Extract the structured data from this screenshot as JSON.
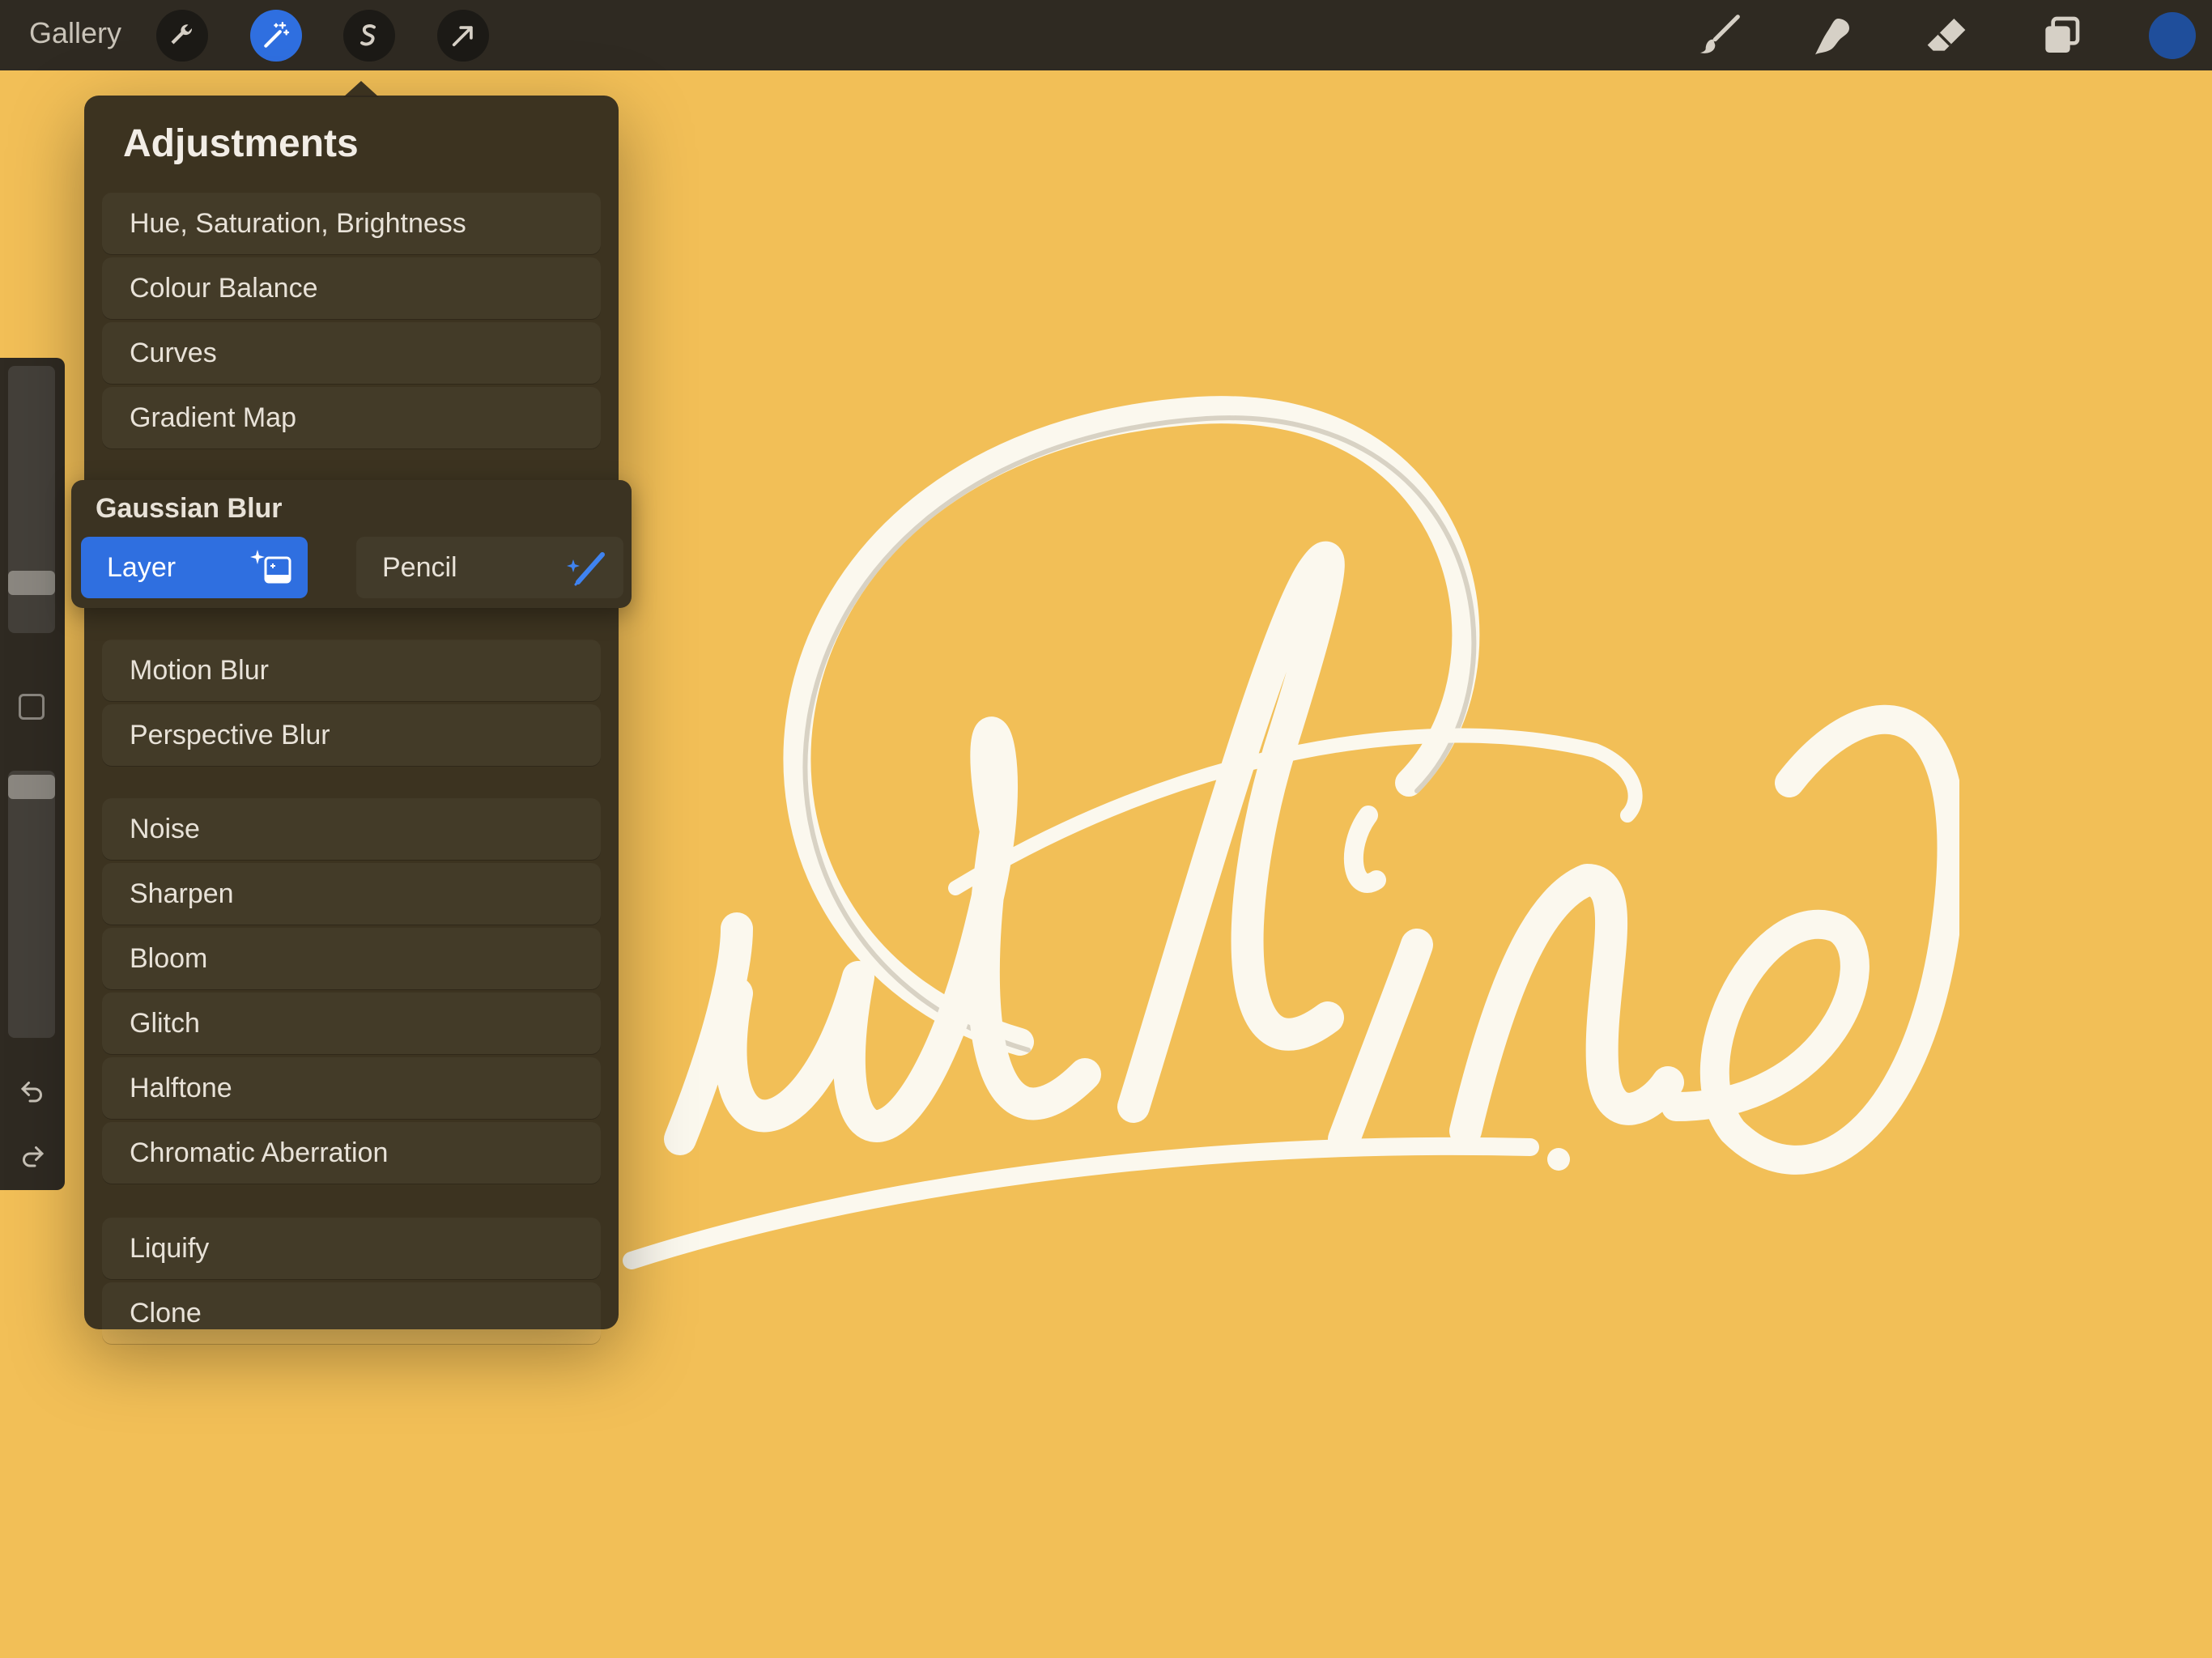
{
  "toolbar": {
    "gallery_label": "Gallery",
    "left_tools": [
      "wrench-icon",
      "magic-wand-icon",
      "selection-icon",
      "transform-arrow-icon"
    ],
    "active_tool": "magic-wand-icon",
    "right_tools": [
      "brush-icon",
      "smudge-icon",
      "eraser-icon",
      "layers-icon"
    ],
    "color": "#1f4e9b"
  },
  "adjustments": {
    "title": "Adjustments",
    "groups": [
      [
        "Hue, Saturation, Brightness",
        "Colour Balance",
        "Curves",
        "Gradient Map"
      ],
      [
        "Motion Blur",
        "Perspective Blur"
      ],
      [
        "Noise",
        "Sharpen",
        "Bloom",
        "Glitch",
        "Halftone",
        "Chromatic Aberration"
      ],
      [
        "Liquify",
        "Clone"
      ]
    ]
  },
  "gaussian_blur": {
    "title": "Gaussian Blur",
    "options": [
      "Layer",
      "Pencil"
    ],
    "selected": "Layer"
  },
  "colors": {
    "canvas": "#f2bf57",
    "accent": "#2f6fe0",
    "lettering": "#fbf8ee"
  }
}
